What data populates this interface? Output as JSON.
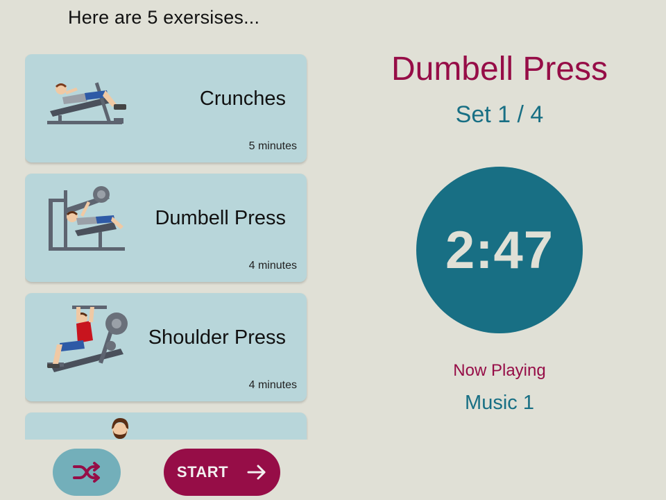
{
  "heading": "Here are 5 exersises...",
  "exercises": [
    {
      "name": "Crunches",
      "duration": "5 minutes",
      "illustration": "crunches-bench-icon"
    },
    {
      "name": "Dumbell Press",
      "duration": "4 minutes",
      "illustration": "leg-press-machine-icon"
    },
    {
      "name": "Shoulder Press",
      "duration": "4 minutes",
      "illustration": "shoulder-press-machine-icon"
    },
    {
      "name": "",
      "duration": "",
      "illustration": "person-head-icon"
    }
  ],
  "current": {
    "exercise": "Dumbell Press",
    "set": "Set 1 / 4",
    "timer": "2:47"
  },
  "music": {
    "label": "Now Playing",
    "track": "Music 1"
  },
  "buttons": {
    "shuffle_icon": "shuffle-icon",
    "start_label": "START",
    "start_icon": "arrow-right-icon"
  },
  "colors": {
    "background": "#e0e0d6",
    "card": "#b8d6da",
    "accent": "#960d47",
    "primary": "#186f84",
    "shuffle_button": "#73afba"
  }
}
